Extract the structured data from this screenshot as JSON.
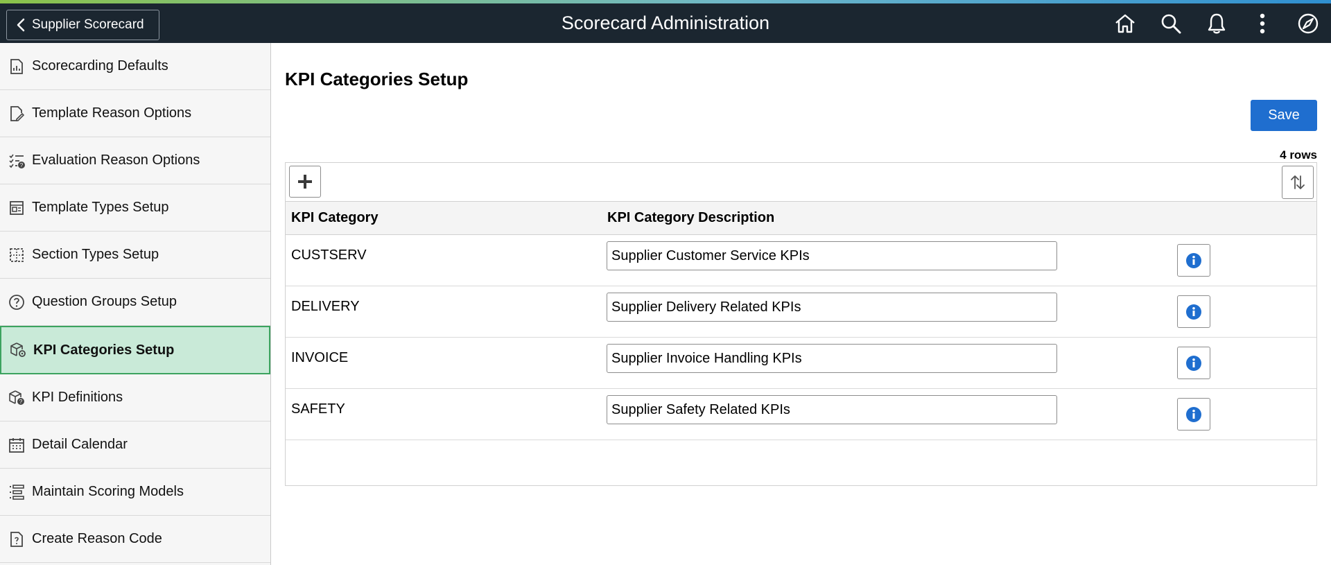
{
  "header": {
    "back_label": "Supplier Scorecard",
    "title": "Scorecard Administration",
    "icons": [
      "home-icon",
      "search-icon",
      "bell-icon",
      "more-vertical-icon",
      "compass-icon"
    ]
  },
  "sidebar": {
    "items": [
      {
        "label": "Scorecarding Defaults",
        "icon": "report-chart-icon"
      },
      {
        "label": "Template Reason Options",
        "icon": "document-edit-icon"
      },
      {
        "label": "Evaluation Reason Options",
        "icon": "checklist-question-icon"
      },
      {
        "label": "Template Types Setup",
        "icon": "template-layout-icon"
      },
      {
        "label": "Section Types Setup",
        "icon": "section-grid-icon"
      },
      {
        "label": "Question Groups Setup",
        "icon": "question-circle-icon"
      },
      {
        "label": "KPI Categories Setup",
        "icon": "cube-gear-icon",
        "active": true
      },
      {
        "label": "KPI Definitions",
        "icon": "cube-info-icon"
      },
      {
        "label": "Detail Calendar",
        "icon": "calendar-icon"
      },
      {
        "label": "Maintain Scoring Models",
        "icon": "list-bars-icon"
      },
      {
        "label": "Create Reason Code",
        "icon": "document-question-icon"
      }
    ]
  },
  "main": {
    "title": "KPI Categories Setup",
    "save_label": "Save",
    "row_count": "4 rows",
    "columns": [
      "KPI Category",
      "KPI Category Description"
    ],
    "rows": [
      {
        "code": "CUSTSERV",
        "description": "Supplier Customer Service KPIs"
      },
      {
        "code": "DELIVERY",
        "description": "Supplier Delivery Related KPIs"
      },
      {
        "code": "INVOICE",
        "description": "Supplier Invoice Handling KPIs"
      },
      {
        "code": "SAFETY",
        "description": "Supplier Safety Related KPIs"
      }
    ]
  },
  "colors": {
    "header_bg": "#1b2630",
    "active_nav_bg": "#c9ead8",
    "active_nav_border": "#3ca35f",
    "save_button": "#1f6ecf",
    "info_icon": "#1f6ecf"
  }
}
